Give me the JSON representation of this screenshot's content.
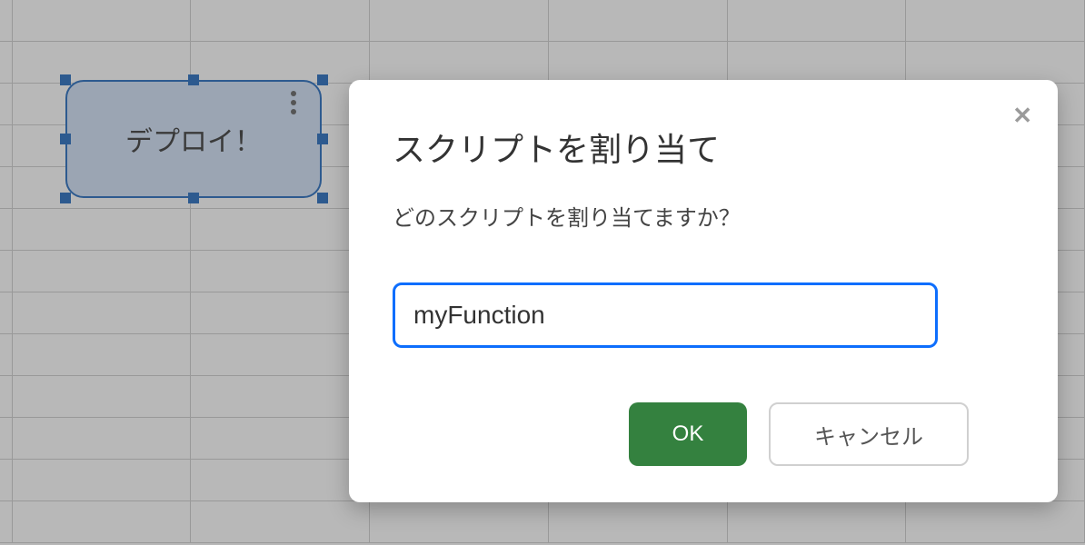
{
  "shape": {
    "label": "デプロイ！"
  },
  "dialog": {
    "title": "スクリプトを割り当て",
    "subtitle": "どのスクリプトを割り当てますか？",
    "input_value": "myFunction",
    "ok_label": "OK",
    "cancel_label": "キャンセル",
    "close_label": "✕"
  },
  "colors": {
    "primary_button": "#34813f",
    "input_border": "#0d6efd",
    "selection": "#2d5a8f"
  }
}
